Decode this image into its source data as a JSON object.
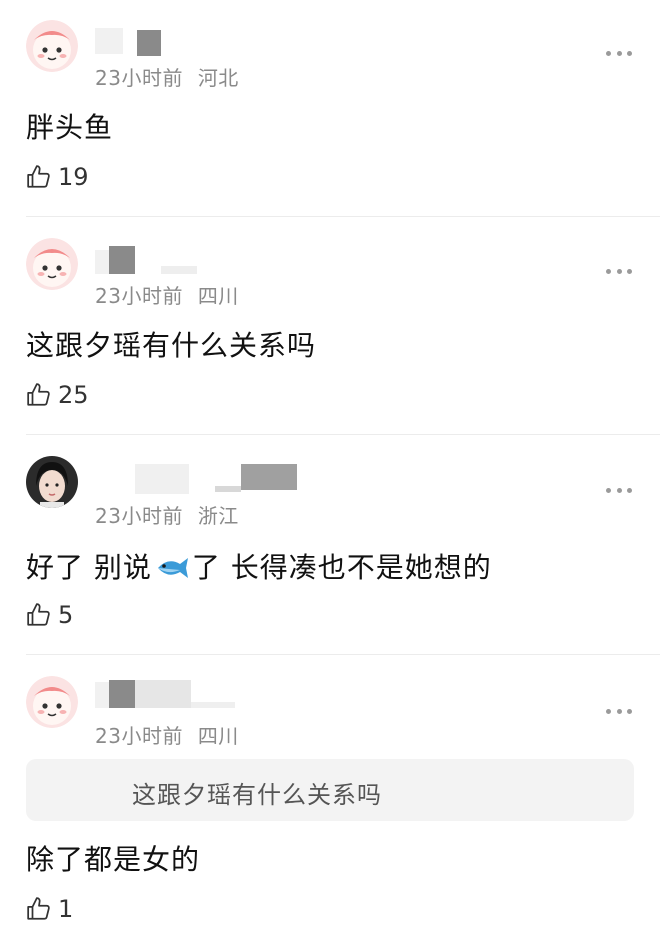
{
  "comments": [
    {
      "avatar": "pink-character-avatar",
      "time": "23小时前",
      "location": "河北",
      "text": "胖头鱼",
      "likes": "19"
    },
    {
      "avatar": "pink-character-avatar",
      "time": "23小时前",
      "location": "四川",
      "text": "这跟夕瑶有什么关系吗",
      "likes": "25"
    },
    {
      "avatar": "photo-avatar",
      "time": "23小时前",
      "location": "浙江",
      "text_before": "好了 别说",
      "emoji": "fish-emoji",
      "text_after": "了 长得凑也不是她想的",
      "likes": "5"
    },
    {
      "avatar": "pink-character-avatar",
      "time": "23小时前",
      "location": "四川",
      "quote": "这跟夕瑶有什么关系吗",
      "text": "除了都是女的",
      "likes": "1"
    }
  ],
  "colors": {
    "meta": "#8a8a8a",
    "quote_bg": "#f3f3f3",
    "fish": "#3b9bd8"
  }
}
